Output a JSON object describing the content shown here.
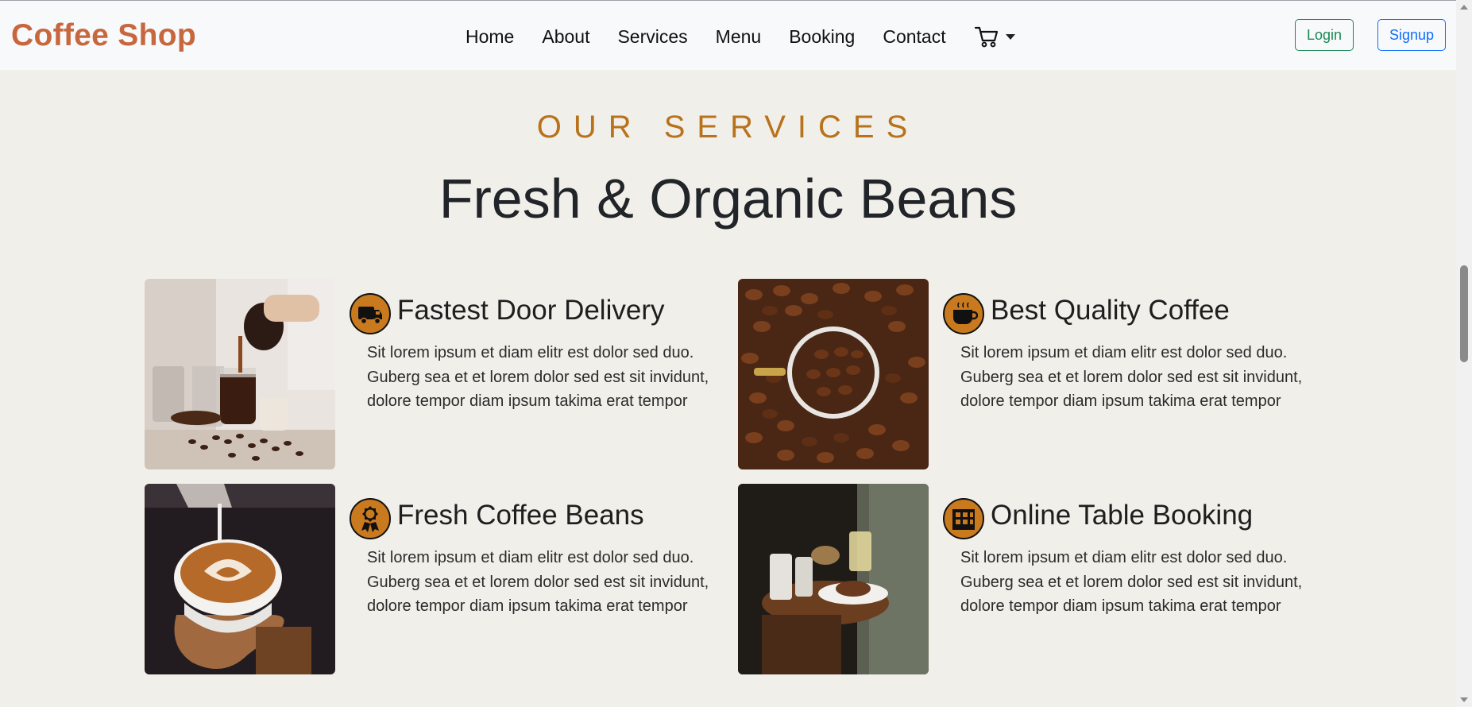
{
  "brand": "Coffee Shop",
  "nav": {
    "links": [
      "Home",
      "About",
      "Services",
      "Menu",
      "Booking",
      "Contact"
    ],
    "cart_icon": "cart-icon",
    "login": "Login",
    "signup": "Signup"
  },
  "colors": {
    "brand": "#c7673e",
    "accent": "#b8721c",
    "login": "#198754",
    "signup": "#0d6efd",
    "background": "#f1efe9"
  },
  "section": {
    "eyebrow": "OUR SERVICES",
    "title": "Fresh & Organic Beans"
  },
  "services": [
    {
      "title": "Fastest Door Delivery",
      "icon": "truck-icon",
      "text": "Sit lorem ipsum et diam elitr est dolor sed duo. Guberg sea et et lorem dolor sed est sit invidunt, dolore tempor diam ipsum takima erat tempor"
    },
    {
      "title": "Best Quality Coffee",
      "icon": "coffee-cup-icon",
      "text": "Sit lorem ipsum et diam elitr est dolor sed duo. Guberg sea et et lorem dolor sed est sit invidunt, dolore tempor diam ipsum takima erat tempor"
    },
    {
      "title": "Fresh Coffee Beans",
      "icon": "award-icon",
      "text": "Sit lorem ipsum et diam elitr est dolor sed duo. Guberg sea et et lorem dolor sed est sit invidunt, dolore tempor diam ipsum takima erat tempor"
    },
    {
      "title": "Online Table Booking",
      "icon": "table-icon",
      "text": "Sit lorem ipsum et diam elitr est dolor sed duo. Guberg sea et et lorem dolor sed est sit invidunt, dolore tempor diam ipsum takima erat tempor"
    }
  ]
}
